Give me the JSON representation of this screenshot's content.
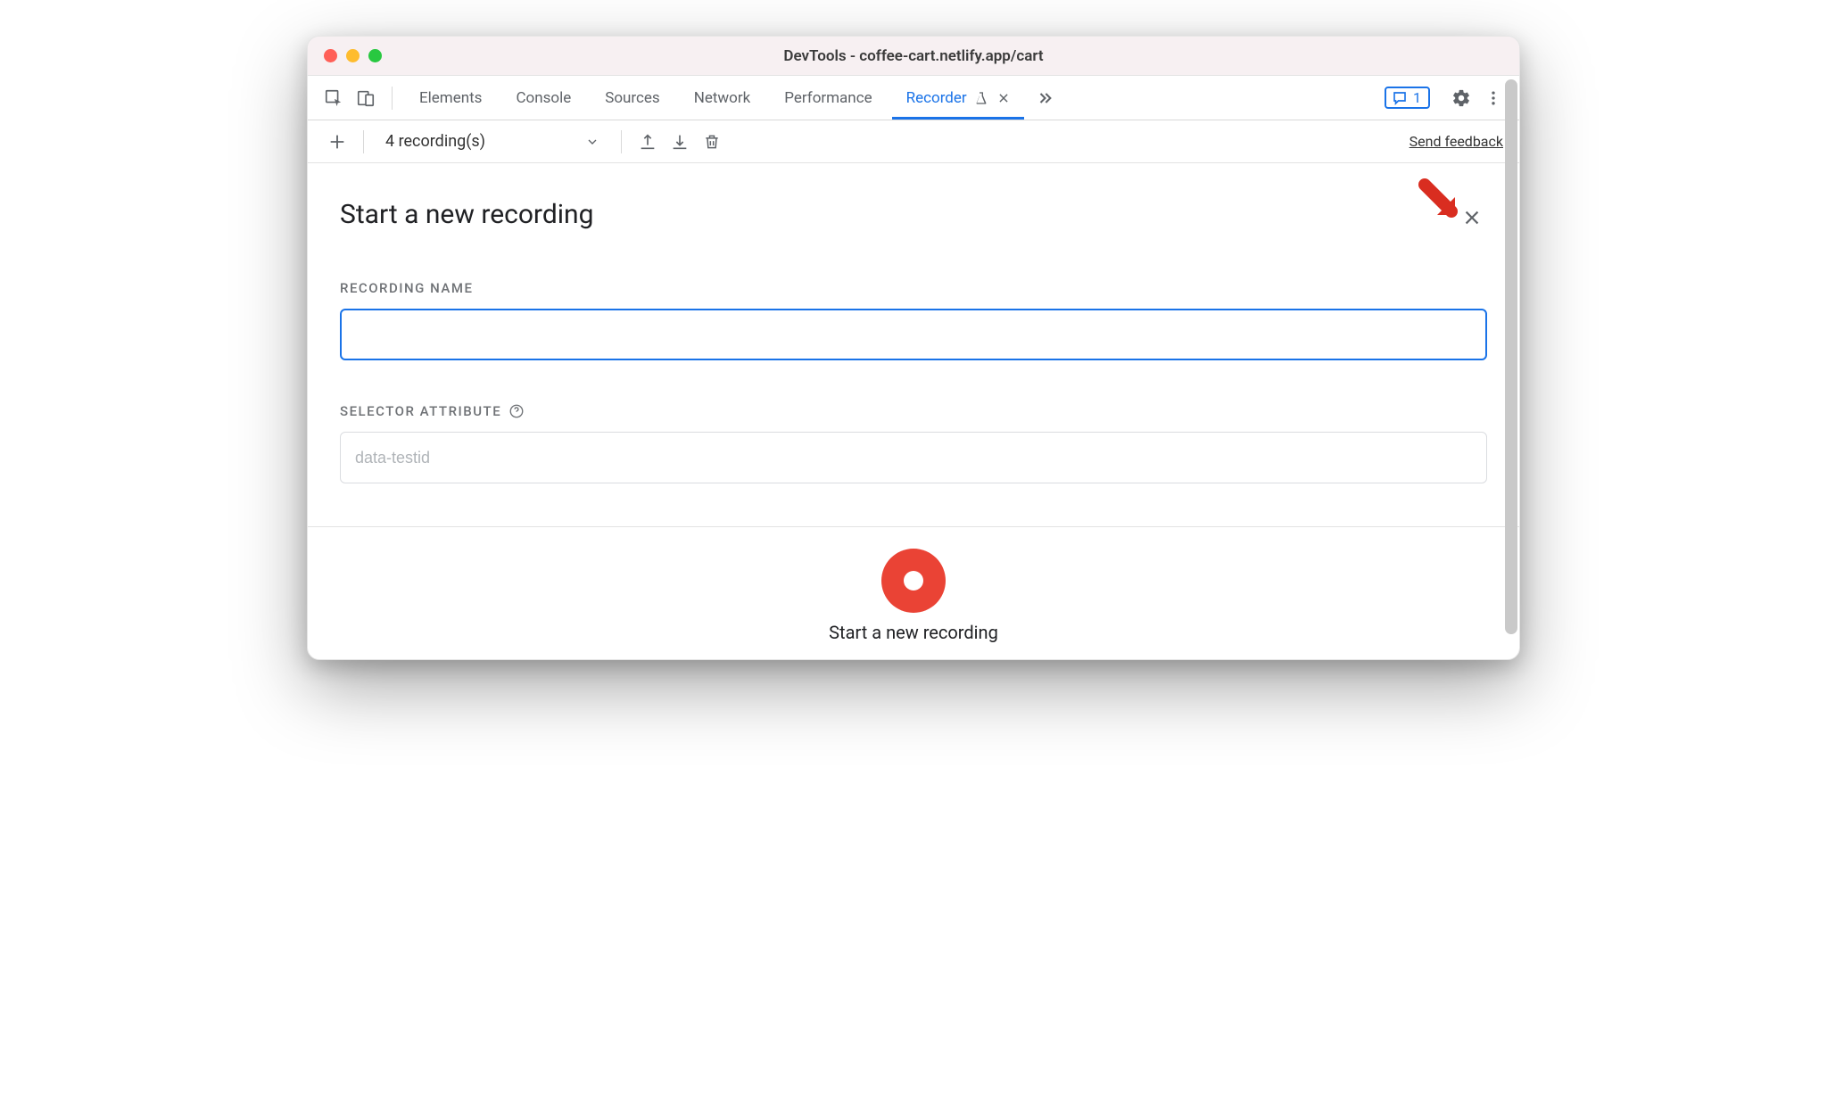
{
  "window": {
    "title": "DevTools - coffee-cart.netlify.app/cart"
  },
  "tabs": {
    "items": [
      "Elements",
      "Console",
      "Sources",
      "Network",
      "Performance"
    ],
    "active": {
      "label": "Recorder"
    }
  },
  "chat_badge": {
    "count": "1"
  },
  "toolbar": {
    "dropdown_label": "4 recording(s)",
    "feedback_link": "Send feedback"
  },
  "panel": {
    "title": "Start a new recording",
    "recording_name_label": "RECORDING NAME",
    "recording_name_value": "",
    "selector_attr_label": "SELECTOR ATTRIBUTE",
    "selector_attr_placeholder": "data-testid"
  },
  "footer": {
    "record_label": "Start a new recording"
  }
}
